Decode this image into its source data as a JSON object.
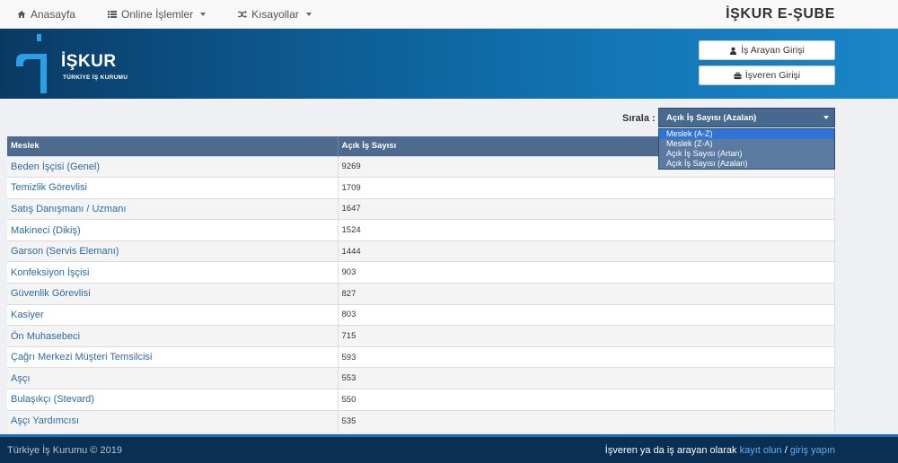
{
  "topnav": {
    "home_label": "Anasayfa",
    "online_label": "Online İşlemler",
    "shortcuts_label": "Kısayollar",
    "brand_title": "İŞKUR E-ŞUBE"
  },
  "banner": {
    "logo_text": "İŞKUR",
    "logo_sub": "TÜRKİYE İŞ KURUMU",
    "job_seeker_login": "İş Arayan Girişi",
    "employer_login": "İşveren Girişi"
  },
  "sort": {
    "label": "Sırala :",
    "selected": "Açık İş Sayısı (Azalan)",
    "options": [
      "Meslek (A-Z)",
      "Meslek (Z-A)",
      "Açık İş Sayısı (Artan)",
      "Açık İş Sayısı (Azalan)"
    ]
  },
  "table": {
    "headers": [
      "Meslek",
      "Açık İş Sayısı"
    ],
    "rows": [
      {
        "name": "Beden İşçisi (Genel)",
        "count": "9269"
      },
      {
        "name": "Temizlik Görevlisi",
        "count": "1709"
      },
      {
        "name": "Satış Danışmanı / Uzmanı",
        "count": "1647"
      },
      {
        "name": "Makineci (Dikiş)",
        "count": "1524"
      },
      {
        "name": "Garson (Servis Elemanı)",
        "count": "1444"
      },
      {
        "name": "Konfeksiyon İşçisi",
        "count": "903"
      },
      {
        "name": "Güvenlik Görevlisi",
        "count": "827"
      },
      {
        "name": "Kasiyer",
        "count": "803"
      },
      {
        "name": "Ön Muhasebeci",
        "count": "715"
      },
      {
        "name": "Çağrı Merkezi Müşteri Temsilcisi",
        "count": "593"
      },
      {
        "name": "Aşçı",
        "count": "553"
      },
      {
        "name": "Bulaşıkçı (Stevard)",
        "count": "550"
      },
      {
        "name": "Aşçı Yardımcısı",
        "count": "535"
      }
    ]
  },
  "footer": {
    "copyright": "Türkiye İş Kurumu © 2019",
    "cta_prefix": "İşveren ya da iş arayan olarak",
    "register_link": "kayıt olun",
    "separator": "/",
    "login_link": "giriş yapın"
  },
  "colors": {
    "header_blue": "#0d5b93",
    "table_header": "#4e6a8e",
    "link": "#2b6aa8",
    "footer_bg": "#0a2f52"
  }
}
